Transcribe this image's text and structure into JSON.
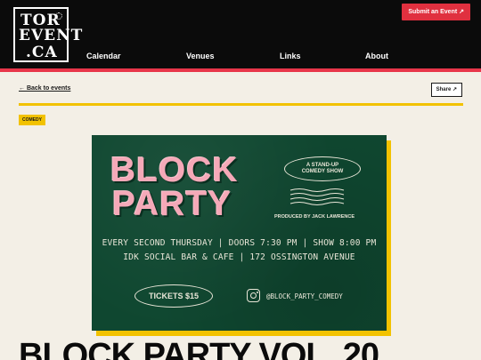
{
  "site": {
    "logo_line1": "TOR",
    "logo_line2": "EVENT",
    "logo_line3": ".CA"
  },
  "nav": {
    "items": [
      {
        "label": "Calendar"
      },
      {
        "label": "Venues"
      },
      {
        "label": "Links"
      },
      {
        "label": "About"
      }
    ],
    "submit_label": "Submit an Event ↗"
  },
  "content": {
    "back_label": "← Back to events",
    "share_label": "Share ↗",
    "category_tag": "COMEDY",
    "event_title": "BLOCK PARTY VOL. 20"
  },
  "poster": {
    "title_line1": "BLOCK",
    "title_line2": "PARTY",
    "subtitle_line1": "A STAND-UP",
    "subtitle_line2": "COMEDY SHOW",
    "produced_by": "PRODUCED BY JACK LAWRENCE",
    "schedule": "EVERY SECOND THURSDAY | DOORS 7:30 PM | SHOW 8:00 PM",
    "venue": "IDK SOCIAL BAR & CAFE | 172 OSSINGTON AVENUE",
    "tickets": "TICKETS $15",
    "instagram": "@BLOCK_PARTY_COMEDY"
  },
  "colors": {
    "header_bg": "#0b0b0b",
    "accent_red": "#e0303f",
    "accent_yellow": "#f2c200",
    "poster_green": "#0f4730",
    "poster_pink": "#f5a9b8",
    "page_bg": "#f3efe6"
  }
}
